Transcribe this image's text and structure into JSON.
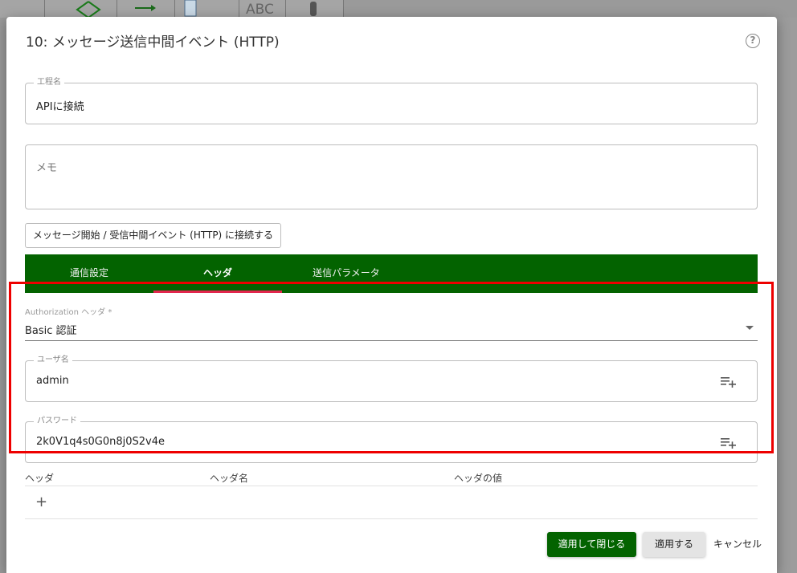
{
  "background": {
    "toolbar_text": "ABC"
  },
  "dialog": {
    "title": "10: メッセージ送信中間イベント (HTTP)",
    "help_icon": "?"
  },
  "process_name": {
    "label": "工程名",
    "value": "APIに接続"
  },
  "memo": {
    "placeholder": "メモ"
  },
  "connect_button": {
    "label": "メッセージ開始 / 受信中間イベント (HTTP) に接続する"
  },
  "tabs": [
    {
      "label": "通信設定",
      "active": false
    },
    {
      "label": "ヘッダ",
      "active": true
    },
    {
      "label": "送信パラメータ",
      "active": false
    }
  ],
  "authorization": {
    "label": "Authorization ヘッダ *",
    "value": "Basic 認証"
  },
  "username": {
    "label": "ユーザ名",
    "value": "admin"
  },
  "password": {
    "label": "パスワード",
    "value": "2k0V1q4s0G0n8j0S2v4e"
  },
  "header_table": {
    "columns": [
      "ヘッダ",
      "ヘッダ名",
      "ヘッダの値"
    ],
    "add_icon": "+"
  },
  "actions": {
    "apply_close": "適用して閉じる",
    "apply": "適用する",
    "cancel": "キャンセル"
  },
  "colors": {
    "primary": "#036300",
    "tab_indicator": "#e2264d",
    "highlight": "#e00000"
  }
}
